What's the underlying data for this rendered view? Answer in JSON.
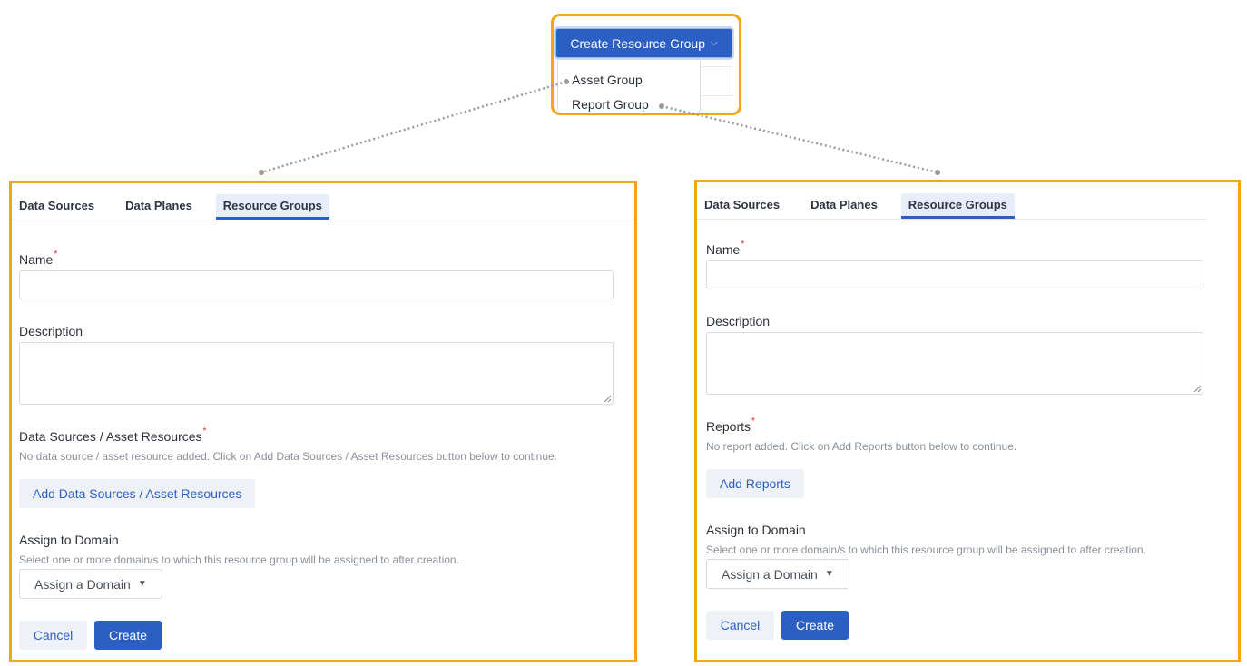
{
  "top": {
    "create_button_label": "Create Resource Group",
    "menu_items": [
      "Asset Group",
      "Report Group"
    ]
  },
  "left_panel": {
    "tabs": [
      "Data Sources",
      "Data Planes",
      "Resource Groups"
    ],
    "active_tab": "Resource Groups",
    "name_label": "Name",
    "description_label": "Description",
    "resources_label": "Data Sources / Asset Resources",
    "resources_hint": "No data source / asset resource added. Click on Add Data Sources / Asset Resources button below to continue.",
    "add_button_label": "Add Data Sources / Asset Resources",
    "domain_label": "Assign to Domain",
    "domain_hint": "Select one or more domain/s to which this resource group will be assigned to after creation.",
    "domain_select_value": "Assign a Domain",
    "cancel_label": "Cancel",
    "create_label": "Create"
  },
  "right_panel": {
    "tabs": [
      "Data Sources",
      "Data Planes",
      "Resource Groups"
    ],
    "active_tab": "Resource Groups",
    "name_label": "Name",
    "description_label": "Description",
    "reports_label": "Reports",
    "reports_hint": "No report added. Click on Add Reports button below to continue.",
    "add_button_label": "Add Reports",
    "domain_label": "Assign to Domain",
    "domain_hint": "Select one or more domain/s to which this resource group will be assigned to after creation.",
    "domain_select_value": "Assign a Domain",
    "cancel_label": "Cancel",
    "create_label": "Create"
  },
  "required_marker": "*",
  "icons": {
    "button_chevron": "chevron-down-icon",
    "select_caret": "caret-down-icon",
    "textarea_grip": "resize-grip-icon"
  },
  "colors": {
    "highlight": "#f2a516",
    "primary": "#2c5fc4",
    "secondary_bg": "#eef1f6",
    "required": "#e02424"
  }
}
